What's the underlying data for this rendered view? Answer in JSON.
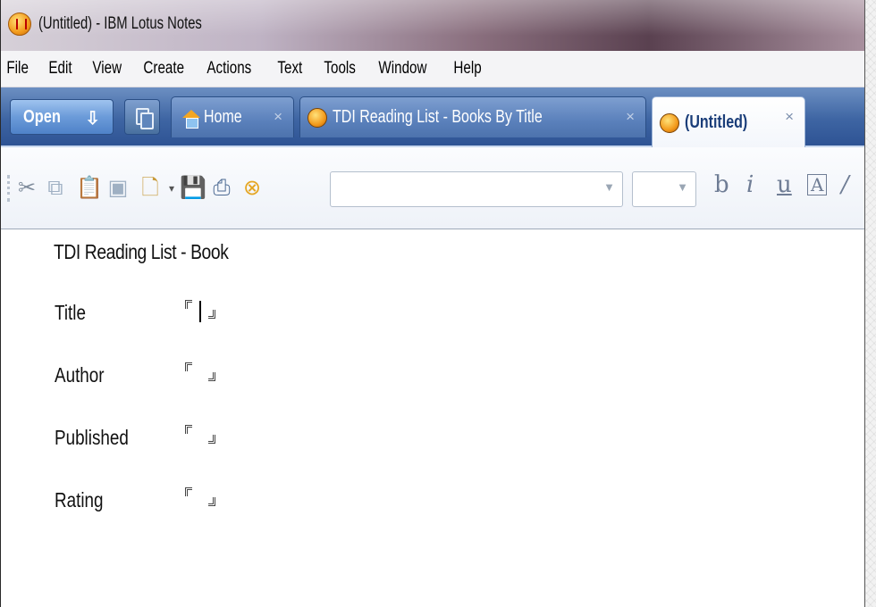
{
  "window": {
    "title": "(Untitled) - IBM Lotus Notes"
  },
  "menubar": {
    "items": [
      "File",
      "Edit",
      "View",
      "Create",
      "Actions",
      "Text",
      "Tools",
      "Window",
      "Help"
    ]
  },
  "tabbar": {
    "open_label": "Open",
    "tabs": [
      {
        "label": "Home",
        "close": "×",
        "icon": "home-icon"
      },
      {
        "label": "TDI Reading List - Books By Title",
        "close": "×",
        "icon": "database-icon"
      },
      {
        "label": "(Untitled)",
        "close": "×",
        "icon": "database-icon",
        "active": true
      }
    ]
  },
  "toolbar": {
    "icons": [
      "cut-icon",
      "copy-icon",
      "paste-icon",
      "paste-special-icon",
      "file-new-icon",
      "save-icon",
      "print-icon",
      "stop-icon"
    ],
    "format_buttons": {
      "bold": "b",
      "italic": "i",
      "underline": "u",
      "text_color": "A",
      "highlight": "∕"
    },
    "font_select": {
      "value": ""
    },
    "size_select": {
      "value": ""
    }
  },
  "document": {
    "form_title": "TDI Reading List - Book",
    "fields": [
      {
        "label": "Title",
        "value": ""
      },
      {
        "label": "Author",
        "value": ""
      },
      {
        "label": "Published",
        "value": ""
      },
      {
        "label": "Rating",
        "value": ""
      }
    ]
  },
  "colors": {
    "tab_bar": "#3e65a3",
    "active_tab_text": "#1a3d79",
    "app_icon": "#f39a1b"
  }
}
